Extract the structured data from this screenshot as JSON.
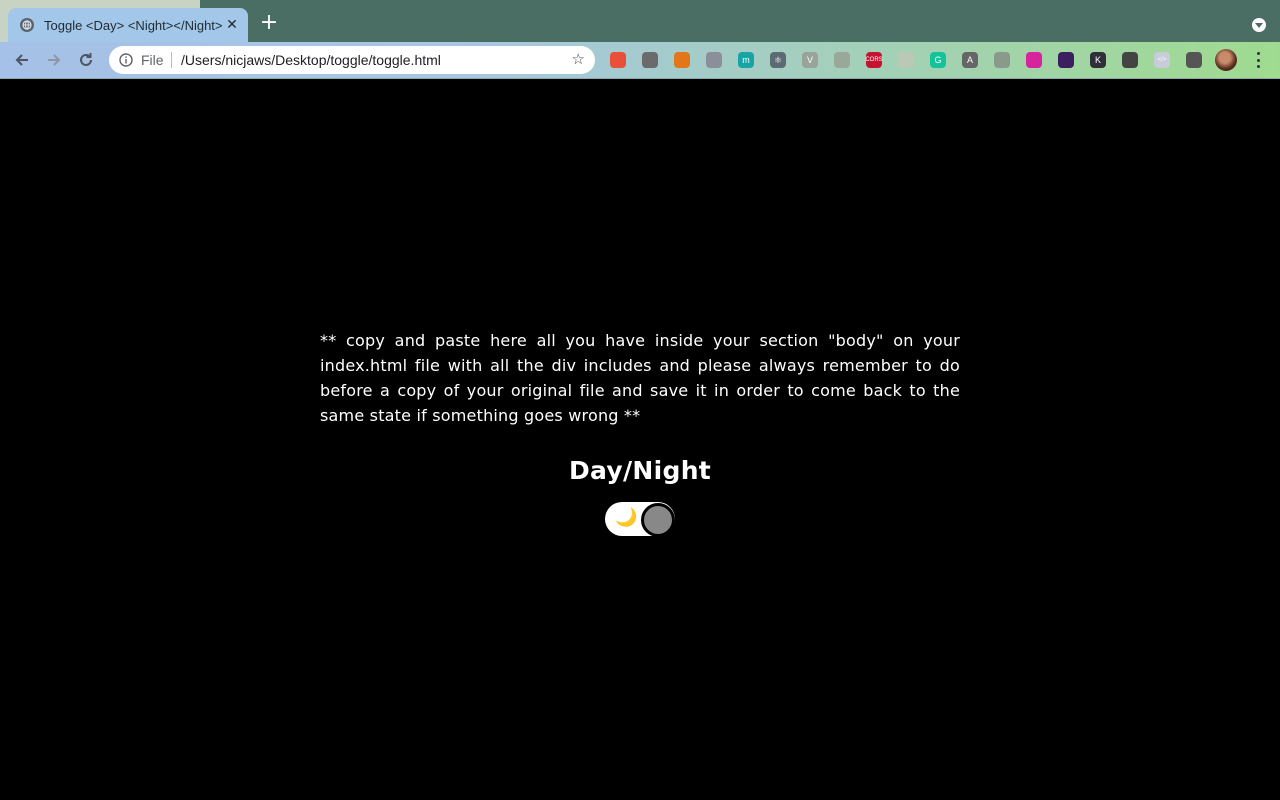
{
  "browser": {
    "tab": {
      "title": "Toggle <Day> <Night></Night>",
      "close_label": "✕"
    },
    "new_tab_label": "+",
    "address_bar": {
      "scheme_label": "File",
      "url": "/Users/nicjaws/Desktop/toggle/toggle.html"
    },
    "extensions": [
      {
        "name": "fire-extension-icon",
        "label": "",
        "color": "#e8503a"
      },
      {
        "name": "eyedropper-extension-icon",
        "label": "",
        "color": "#6b6b6b"
      },
      {
        "name": "metamask-extension-icon",
        "label": "",
        "color": "#e2761b"
      },
      {
        "name": "sync-extension-icon",
        "label": "",
        "color": "#8a8f99"
      },
      {
        "name": "m-extension-icon",
        "label": "m",
        "color": "#16a4a4"
      },
      {
        "name": "react-devtools-icon",
        "label": "⚛",
        "color": "#5c6b73"
      },
      {
        "name": "vue-devtools-icon",
        "label": "V",
        "color": "#9aa39a"
      },
      {
        "name": "target-extension-icon",
        "label": "",
        "color": "#9aa89a"
      },
      {
        "name": "cors-extension-icon",
        "label": "CORS",
        "color": "#c4122f"
      },
      {
        "name": "blank-extension-icon",
        "label": "",
        "color": "#b9c9b6"
      },
      {
        "name": "grammarly-extension-icon",
        "label": "G",
        "color": "#15c39a"
      },
      {
        "name": "a-extension-icon",
        "label": "A",
        "color": "#666"
      },
      {
        "name": "chart-extension-icon",
        "label": "",
        "color": "#8a9a8a"
      },
      {
        "name": "instagram-extension-icon",
        "label": "",
        "color": "#d6249f"
      },
      {
        "name": "imdb-like-extension-icon",
        "label": "",
        "color": "#3b1f5e"
      },
      {
        "name": "k-extension-icon",
        "label": "K",
        "color": "#2f2f3a"
      },
      {
        "name": "square-extension-icon",
        "label": "",
        "color": "#444"
      },
      {
        "name": "code-extension-icon",
        "label": "</>",
        "color": "#c8ccd8"
      },
      {
        "name": "puzzle-extensions-icon",
        "label": "",
        "color": "#555"
      }
    ]
  },
  "page": {
    "paragraph": "** copy and paste here all you have inside your section \"body\" on your index.html file with all the div includes and please always remember to do before a copy of your original file and save it in order to come back to the same state if something goes wrong **",
    "heading": "Day/Night",
    "toggle": {
      "state": "night",
      "icon": "🌙"
    }
  }
}
